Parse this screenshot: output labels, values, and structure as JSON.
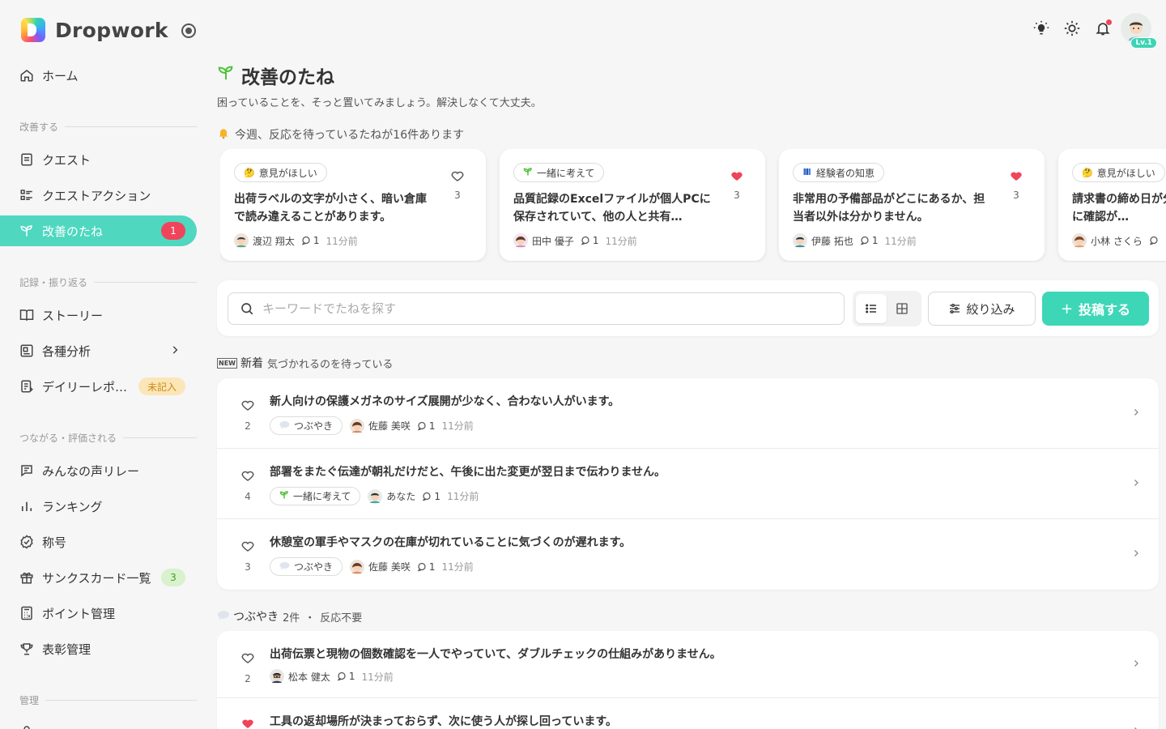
{
  "app": {
    "name": "Dropwork"
  },
  "header": {
    "level_badge": "Lv.1"
  },
  "sidebar": {
    "home": "ホーム",
    "section_improve": "改善する",
    "quest": "クエスト",
    "quest_action": "クエストアクション",
    "seeds": "改善のたね",
    "seeds_badge": "1",
    "section_record": "記録・振り返る",
    "story": "ストーリー",
    "analysis": "各種分析",
    "daily_report": "デイリーレポ…",
    "daily_badge": "未記入",
    "section_connect": "つながる・評価される",
    "voice_relay": "みんなの声リレー",
    "ranking": "ランキング",
    "titles": "称号",
    "thanks_cards": "サンクスカード一覧",
    "thanks_badge": "3",
    "points": "ポイント管理",
    "awards": "表彰管理",
    "section_admin": "管理"
  },
  "page": {
    "title": "改善のたね",
    "subtitle": "困っていることを、そっと置いてみましょう。解決しなくて大丈夫。",
    "week_note": "今週、反応を待っているたねが16件あります"
  },
  "featured": [
    {
      "tag": "意見がほしい",
      "tag_icon": "thinking-emoji",
      "title": "出荷ラベルの文字が小さく、暗い倉庫で読み違えることがあります。",
      "likes": "3",
      "liked": false,
      "author": "渡辺 翔太",
      "comments": "1",
      "time": "11分前"
    },
    {
      "tag": "一緒に考えて",
      "tag_icon": "sprout-emoji",
      "title": "品質記録のExcelファイルが個人PCに保存されていて、他の人と共有…",
      "likes": "3",
      "liked": true,
      "author": "田中 優子",
      "comments": "1",
      "time": "11分前"
    },
    {
      "tag": "経験者の知恵",
      "tag_icon": "books-emoji",
      "title": "非常用の予備部品がどこにあるか、担当者以外は分かりません。",
      "likes": "3",
      "liked": true,
      "author": "伊藤 拓也",
      "comments": "1",
      "time": "11分前"
    },
    {
      "tag": "意見がほしい",
      "tag_icon": "thinking-emoji",
      "title": "請求書の締め日が分かりにくい、月末に確認が…",
      "likes": "",
      "liked": false,
      "author": "小林 さくら",
      "comments": "",
      "time": ""
    }
  ],
  "search": {
    "placeholder": "キーワードでたねを探す"
  },
  "toolbar": {
    "filter": "絞り込み",
    "post": "投稿する"
  },
  "new_section": {
    "badge": "NEW",
    "label": "新着",
    "sub": "気づかれるのを待っている"
  },
  "new_items": [
    {
      "title": "新人向けの保護メガネのサイズ展開が少なく、合わない人がいます。",
      "likes": "2",
      "liked": false,
      "tag": "つぶやき",
      "tag_icon": "speech-bubble-emoji",
      "author": "佐藤 美咲",
      "comments": "1",
      "time": "11分前"
    },
    {
      "title": "部署をまたぐ伝達が朝礼だけだと、午後に出た変更が翌日まで伝わりません。",
      "likes": "4",
      "liked": false,
      "tag": "一緒に考えて",
      "tag_icon": "sprout-emoji",
      "author": "あなた",
      "comments": "1",
      "time": "11分前"
    },
    {
      "title": "休憩室の軍手やマスクの在庫が切れていることに気づくのが遅れます。",
      "likes": "3",
      "liked": false,
      "tag": "つぶやき",
      "tag_icon": "speech-bubble-emoji",
      "author": "佐藤 美咲",
      "comments": "1",
      "time": "11分前"
    }
  ],
  "mutter_section": {
    "label": "つぶやき",
    "count": "2件",
    "sep": "・",
    "sub": "反応不要"
  },
  "mutter_items": [
    {
      "title": "出荷伝票と現物の個数確認を一人でやっていて、ダブルチェックの仕組みがありません。",
      "likes": "2",
      "liked": false,
      "author": "松本 健太",
      "comments": "1",
      "time": "11分前"
    },
    {
      "title": "工具の返却場所が決まっておらず、次に使う人が探し回っています。",
      "likes": "",
      "liked": true,
      "author": "",
      "comments": "",
      "time": ""
    }
  ],
  "colors": {
    "accent": "#3dd7b7",
    "heart": "#f0445a",
    "badge_red": "#f0445a"
  }
}
